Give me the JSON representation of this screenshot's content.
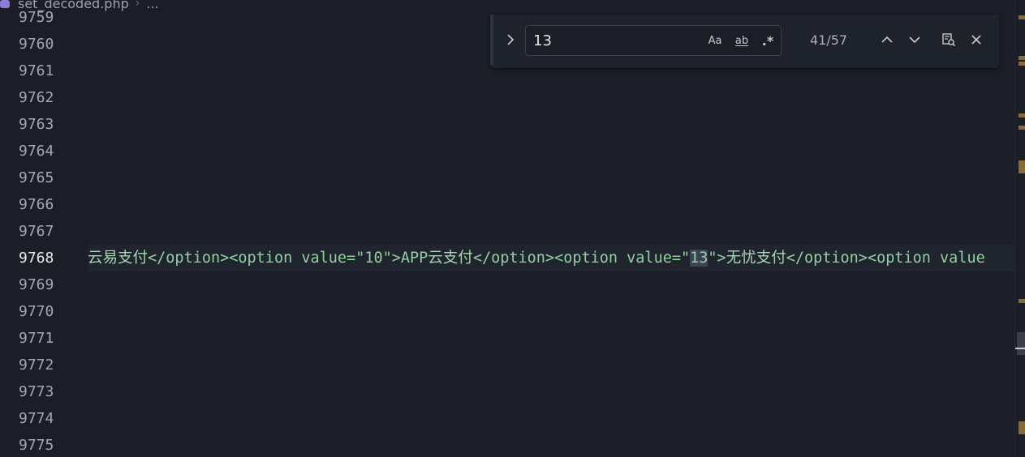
{
  "breadcrumb": {
    "file": "set_decoded.php",
    "more": "..."
  },
  "gutter": {
    "lines": [
      "9759",
      "9760",
      "9761",
      "9762",
      "9763",
      "9764",
      "9765",
      "9766",
      "9767",
      "9768",
      "9769",
      "9770",
      "9771",
      "9772",
      "9773",
      "9774",
      "9775"
    ],
    "active_line": "9768"
  },
  "code": {
    "segment_1_cjk": "云易支付",
    "segment_2": "</option><option value=\"10\">APP",
    "segment_3_cjk": "云支付",
    "segment_4": "</option><option value=\"",
    "match": "13",
    "segment_5": "\">",
    "segment_6_cjk": "无忧支付",
    "segment_7": "</option><option value"
  },
  "find": {
    "query": "13",
    "match_case_label": "Aa",
    "whole_word_label": "ab",
    "regex_label": ".*",
    "match_count": "41/57",
    "icons": {
      "toggle": "chevron-right-icon",
      "prev": "arrow-up-icon",
      "next": "arrow-down-icon",
      "select": "find-in-selection-icon",
      "close": "close-icon"
    }
  },
  "colors": {
    "background": "#1b1e27",
    "code_text": "#93d0a0",
    "line_number": "#a4a8b2",
    "ruler_marker": "#8a6a3a"
  }
}
